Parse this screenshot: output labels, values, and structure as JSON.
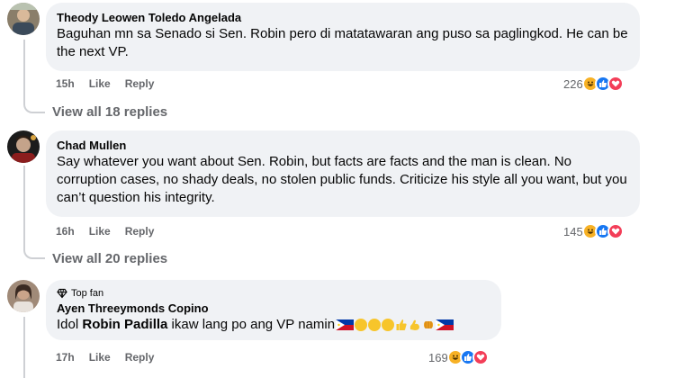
{
  "comments": [
    {
      "author": "Theody Leowen Toledo Angelada",
      "text": "Baguhan mn sa Senado si Sen. Robin pero di matatawaran ang puso sa paglingkod. He can be the next VP.",
      "time": "15h",
      "like_label": "Like",
      "reply_label": "Reply",
      "reaction_count": "226",
      "view_replies": "View all 18 replies"
    },
    {
      "author": "Chad Mullen",
      "text": "Say whatever you want about Sen. Robin, but facts are facts and the man is clean. No corruption cases, no shady deals, no stolen public funds. Criticize his style all you want, but you can’t question his integrity.",
      "time": "16h",
      "like_label": "Like",
      "reply_label": "Reply",
      "reaction_count": "145",
      "view_replies": "View all 20 replies"
    },
    {
      "badge": "Top fan",
      "author": "Ayen Threeymonds Copino",
      "text_pre": "Idol ",
      "text_bold": "Robin Padilla",
      "text_post": " ikaw lang po ang VP namin",
      "time": "17h",
      "like_label": "Like",
      "reply_label": "Reply",
      "reaction_count": "169"
    }
  ],
  "reaction_icons": [
    "haha-icon",
    "like-icon",
    "love-icon"
  ],
  "colors": {
    "bubble": "#f0f2f5",
    "meta": "#65676b",
    "like_blue": "#1877f2",
    "love_red": "#f33e58",
    "haha_yellow": "#f7b125"
  }
}
